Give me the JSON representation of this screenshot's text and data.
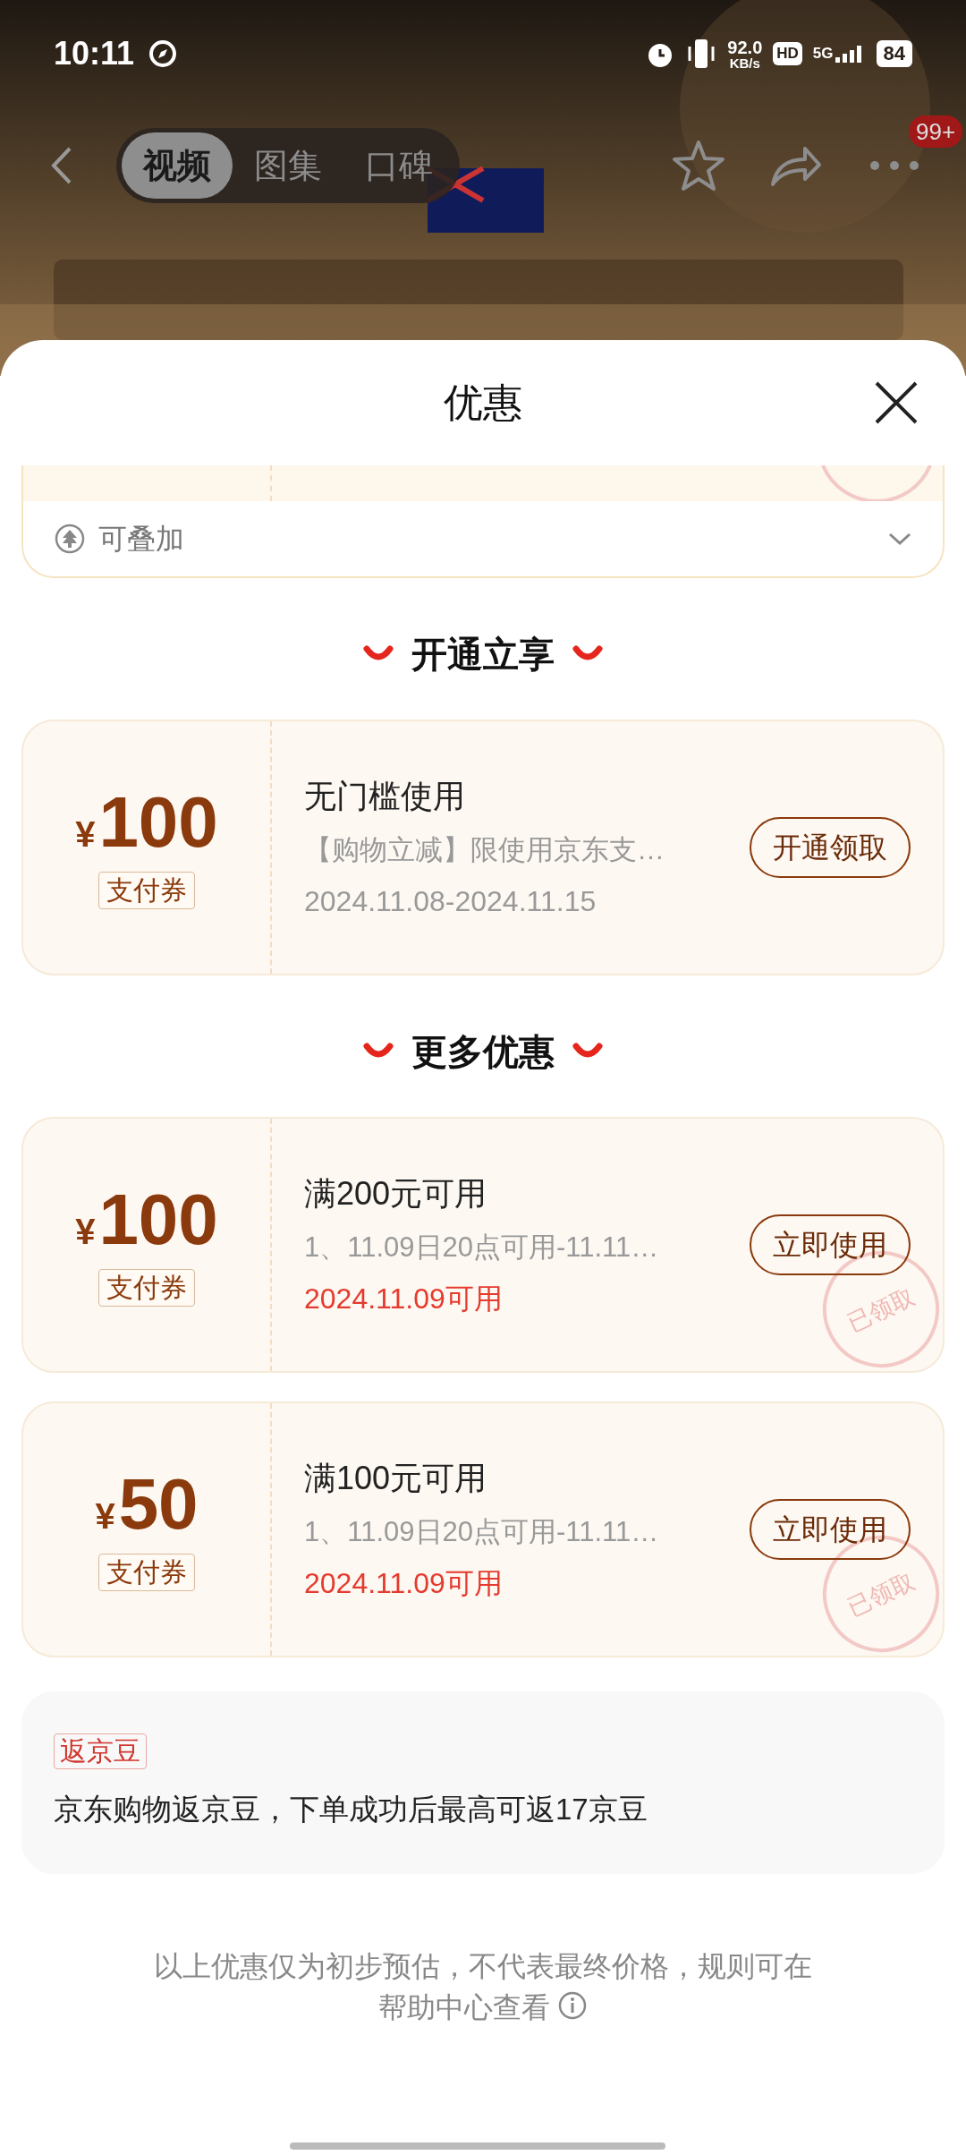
{
  "status_bar": {
    "time": "10:11",
    "net_speed": "92.0",
    "net_unit": "KB/s",
    "hd": "HD",
    "network": "5G",
    "battery": "84"
  },
  "nav": {
    "tabs": [
      {
        "label": "视频",
        "selected": true
      },
      {
        "label": "图集",
        "selected": false
      },
      {
        "label": "口碑",
        "selected": false
      }
    ],
    "badge": "99+"
  },
  "sheet": {
    "title": "优惠"
  },
  "stack_row": {
    "label": "可叠加"
  },
  "sections": [
    {
      "title": "开通立享",
      "coupons": [
        {
          "currency": "¥",
          "amount": "100",
          "type": "支付券",
          "title": "无门槛使用",
          "description": "【购物立减】限使用京东支…",
          "validity": "2024.11.08-2024.11.15",
          "validity_highlight": false,
          "button": "开通领取"
        }
      ]
    },
    {
      "title": "更多优惠",
      "coupons": [
        {
          "currency": "¥",
          "amount": "100",
          "type": "支付券",
          "title": "满200元可用",
          "description": "1、11.09日20点可用-11.11…",
          "validity": "2024.11.09可用",
          "validity_highlight": true,
          "button": "立即使用",
          "stamp": "已领取"
        },
        {
          "currency": "¥",
          "amount": "50",
          "type": "支付券",
          "title": "满100元可用",
          "description": "1、11.09日20点可用-11.11…",
          "validity": "2024.11.09可用",
          "validity_highlight": true,
          "button": "立即使用",
          "stamp": "已领取"
        }
      ]
    }
  ],
  "beans": {
    "tag": "返京豆",
    "text": "京东购物返京豆，下单成功后最高可返17京豆"
  },
  "footer": {
    "text": "以上优惠仅为初步预估，不代表最终价格，规则可在帮助中心查看"
  }
}
